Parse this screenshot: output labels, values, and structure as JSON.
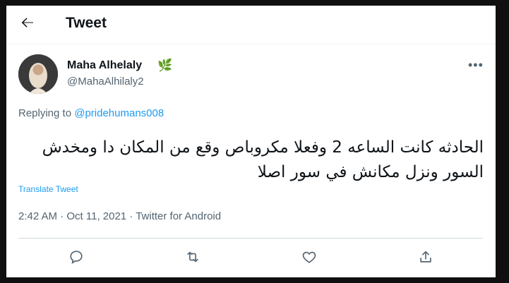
{
  "header": {
    "back_icon": "arrow-left-icon",
    "title": "Tweet"
  },
  "author": {
    "name": "Maha Alhelaly",
    "name_emoji": "🌿",
    "handle": "@MahaAlhilaly2"
  },
  "tweet": {
    "replying_prefix": "Replying to ",
    "replying_handle": "@pridehumans008",
    "text": "الحادثه كانت الساعه 2 وفعلا مكروباص وقع من المكان دا ومخدش السور ونزل مكانش في سور اصلا",
    "translate_label": "Translate Tweet",
    "meta": "2:42 AM · Oct 11, 2021 · Twitter for Android"
  },
  "actions": [
    "reply-icon",
    "retweet-icon",
    "like-icon",
    "share-icon"
  ],
  "colors": {
    "accent": "#1d9bf0",
    "text": "#0f1419",
    "secondary": "#536471"
  }
}
